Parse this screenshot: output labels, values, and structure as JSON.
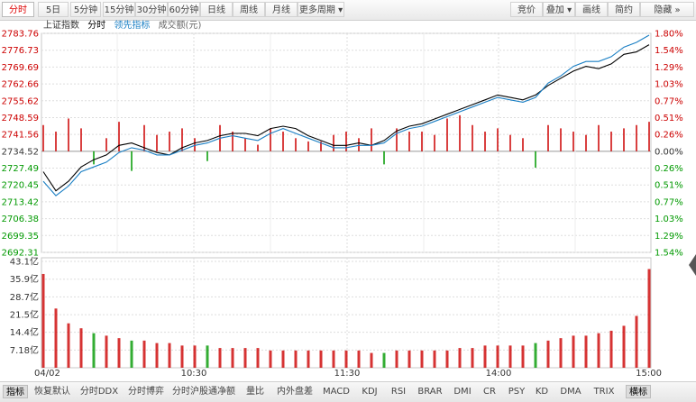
{
  "toolbar": {
    "left_tabs": [
      "分时",
      "5日",
      "5分钟",
      "15分钟",
      "30分钟",
      "60分钟",
      "日线",
      "周线",
      "月线",
      "更多周期"
    ],
    "right_tabs": [
      "竞价",
      "叠加",
      "画线",
      "简约",
      "隐藏"
    ]
  },
  "legend": {
    "index_name": "上证指数",
    "mode": "分时",
    "leading_label": "领先指标",
    "volume_label": "成交额(元)"
  },
  "colors": {
    "up": "#cc0000",
    "down": "#009900",
    "price_line": "#000000",
    "leading_line": "#1a7fc4",
    "grid": "#dddddd"
  },
  "chart_data": [
    {
      "type": "line",
      "title": "上证指数 分时",
      "y_ticks_price": [
        "2783.76",
        "2776.73",
        "2769.69",
        "2762.66",
        "2755.62",
        "2748.59",
        "2741.56",
        "2734.52",
        "2727.49",
        "2720.45",
        "2713.42",
        "2706.38",
        "2699.35",
        "2692.31"
      ],
      "y_ticks_pct": [
        "1.80%",
        "1.54%",
        "1.29%",
        "1.03%",
        "0.77%",
        "0.51%",
        "0.26%",
        "0.00%",
        "0.26%",
        "0.51%",
        "0.77%",
        "1.03%",
        "1.29%",
        "1.54%"
      ],
      "ylim": [
        2692.31,
        2783.76
      ],
      "prev_close": 2734.52,
      "x_labels": [
        "04/02",
        "10:30",
        "11:30",
        "14:00",
        "15:00"
      ],
      "x": [
        "09:30",
        "09:35",
        "09:40",
        "09:45",
        "09:50",
        "09:55",
        "10:00",
        "10:05",
        "10:10",
        "10:15",
        "10:20",
        "10:25",
        "10:30",
        "10:35",
        "10:40",
        "10:45",
        "10:50",
        "10:55",
        "11:00",
        "11:05",
        "11:10",
        "11:15",
        "11:20",
        "11:25",
        "11:30",
        "13:05",
        "13:10",
        "13:15",
        "13:20",
        "13:25",
        "13:30",
        "13:35",
        "13:40",
        "13:45",
        "13:50",
        "13:55",
        "14:00",
        "14:05",
        "14:10",
        "14:15",
        "14:20",
        "14:25",
        "14:30",
        "14:35",
        "14:40",
        "14:45",
        "14:50",
        "14:55",
        "15:00"
      ],
      "series": [
        {
          "name": "分时",
          "values": [
            2726,
            2718,
            2722,
            2728,
            2731,
            2733,
            2737,
            2738,
            2736,
            2734,
            2733,
            2736,
            2738,
            2739,
            2741,
            2742,
            2742,
            2741,
            2744,
            2745,
            2744,
            2741,
            2739,
            2737,
            2737,
            2738,
            2737,
            2739,
            2743,
            2745,
            2746,
            2748,
            2750,
            2752,
            2754,
            2756,
            2758,
            2757,
            2756,
            2758,
            2762,
            2765,
            2768,
            2770,
            2769,
            2771,
            2775,
            2776,
            2779
          ]
        },
        {
          "name": "领先指标",
          "values": [
            2722,
            2716,
            2720,
            2726,
            2728,
            2730,
            2734,
            2736,
            2735,
            2733,
            2733,
            2735,
            2737,
            2738,
            2740,
            2741,
            2740,
            2739,
            2742,
            2744,
            2742,
            2740,
            2738,
            2736,
            2736,
            2737,
            2737,
            2738,
            2742,
            2744,
            2745,
            2747,
            2749,
            2751,
            2753,
            2755,
            2757,
            2756,
            2755,
            2757,
            2763,
            2766,
            2770,
            2772,
            2772,
            2774,
            2778,
            2780,
            2783
          ]
        }
      ],
      "bars_pct": [
        0.4,
        0.3,
        0.5,
        0.35,
        -0.2,
        0.2,
        0.45,
        -0.3,
        0.4,
        0.25,
        0.3,
        0.35,
        0.2,
        -0.15,
        0.4,
        0.3,
        0.2,
        0.1,
        0.35,
        0.3,
        0.2,
        0.15,
        0.15,
        0.25,
        0.3,
        0.2,
        0.35,
        -0.2,
        0.35,
        0.3,
        0.3,
        0.25,
        0.5,
        0.55,
        0.4,
        0.3,
        0.35,
        0.25,
        0.2,
        -0.25,
        0.4,
        0.35,
        0.3,
        0.25,
        0.4,
        0.3,
        0.35,
        0.4,
        0.45
      ]
    },
    {
      "type": "bar",
      "title": "成交额(元)",
      "y_ticks": [
        "43.1亿",
        "35.9亿",
        "28.7亿",
        "21.5亿",
        "14.4亿",
        "7.18亿"
      ],
      "ylim": [
        0,
        43.1
      ],
      "unit": "亿",
      "values": [
        38,
        24,
        18,
        16,
        14,
        13,
        12,
        11,
        11,
        10,
        10,
        9,
        9,
        9,
        8,
        8,
        8,
        8,
        7,
        7,
        7,
        7,
        7,
        7,
        7,
        7,
        6,
        6,
        7,
        7,
        7,
        7,
        7,
        8,
        8,
        9,
        9,
        9,
        9,
        10,
        11,
        12,
        13,
        13,
        14,
        15,
        17,
        21,
        40
      ]
    }
  ],
  "bottom_tabs": [
    "指标",
    "恢复默认",
    "分时DDX",
    "分时博弈",
    "分时沪股通净额",
    "量比",
    "内外盘差",
    "MACD",
    "KDJ",
    "RSI",
    "BRAR",
    "DMI",
    "CR",
    "PSY",
    "KD",
    "DMA",
    "TRIX",
    "横标"
  ]
}
